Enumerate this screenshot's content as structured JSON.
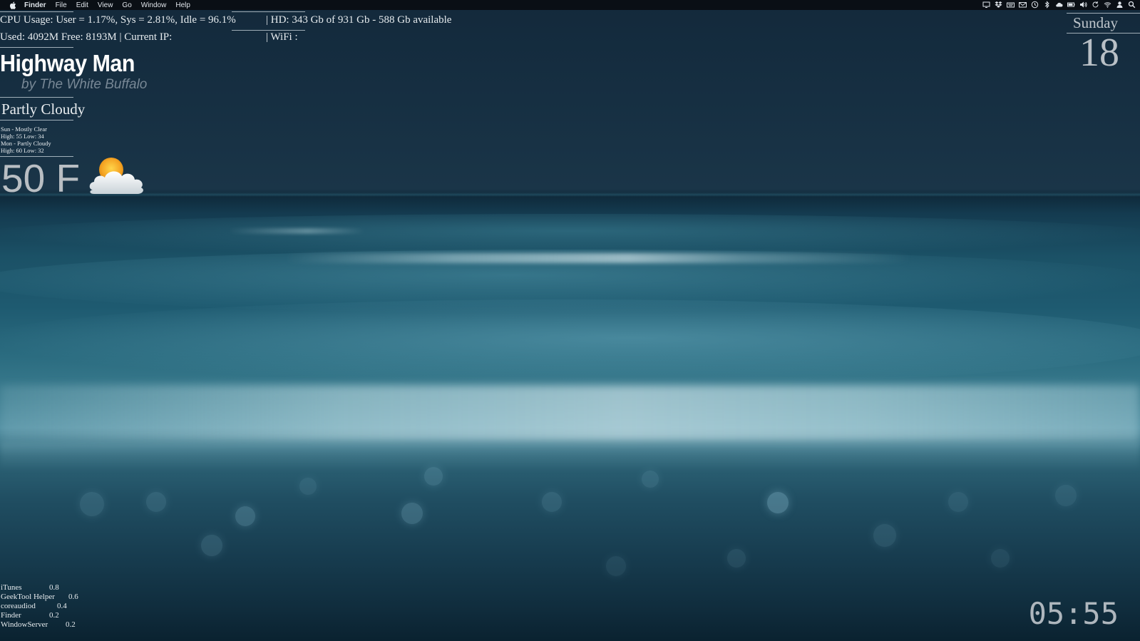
{
  "menubar": {
    "app_name": "Finder",
    "items": [
      "File",
      "Edit",
      "View",
      "Go",
      "Window",
      "Help"
    ],
    "tray_icons": [
      "display-icon",
      "dropbox-icon",
      "keyboard-icon",
      "mail-icon",
      "time-machine-icon",
      "bluetooth-icon",
      "cloud-icon",
      "battery-icon",
      "wifi-icon",
      "volume-icon",
      "sync-icon",
      "airport-icon",
      "user-icon",
      "search-icon"
    ]
  },
  "system": {
    "cpu": "CPU Usage:  User = 1.17%, Sys = 2.81%, Idle = 96.1%",
    "hd": "|  HD:  343 Gb of 931 Gb - 588 Gb available",
    "memory": "Used: 4092M Free: 8193M  |  Current IP:",
    "wifi": "|  WiFi :"
  },
  "now_playing": {
    "title": "Highway Man",
    "artist": "by The White Buffalo"
  },
  "weather": {
    "condition": "Partly Cloudy",
    "forecast": [
      "Sun - Mostly Clear",
      "High: 55 Low: 34",
      "Mon - Partly Cloudy",
      "High: 60 Low: 32"
    ],
    "temperature": "50 F",
    "icon": "partly-cloudy-icon"
  },
  "date": {
    "day_name": "Sunday",
    "day_number": "18"
  },
  "processes": [
    {
      "name": "iTunes",
      "cpu": "0.8"
    },
    {
      "name": "GeekTool Helper",
      "cpu": "0.6"
    },
    {
      "name": "coreaudiod",
      "cpu": "0.4"
    },
    {
      "name": "Finder",
      "cpu": "0.2"
    },
    {
      "name": "WindowServer",
      "cpu": "0.2"
    }
  ],
  "clock": "05:55"
}
